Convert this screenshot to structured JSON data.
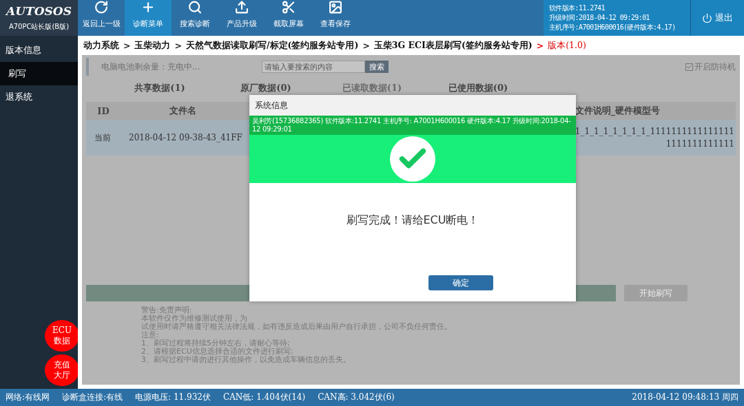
{
  "header": {
    "logo": "AUTOSOS",
    "edition": "A70PC站长版(B版)",
    "nav": [
      {
        "label": "返回上一级",
        "kind": "refresh",
        "selected": false
      },
      {
        "label": "诊断菜单",
        "kind": "medkit",
        "selected": true
      },
      {
        "label": "搜索诊断",
        "kind": "search",
        "selected": false
      },
      {
        "label": "产品升级",
        "kind": "upload",
        "selected": false
      },
      {
        "label": "截取屏幕",
        "kind": "scissors",
        "selected": false
      },
      {
        "label": "查看保存",
        "kind": "image",
        "selected": false
      }
    ],
    "info": [
      "软件版本:11.2741",
      "升级时间:2018-04-12 09:29:01",
      "主机序号:A7001H600016(硬件版本:4.17)"
    ],
    "logout": "退出"
  },
  "sidebar": {
    "items": [
      {
        "label": "版本信息",
        "selected": false
      },
      {
        "label": "刷写",
        "selected": true
      },
      {
        "label": "退系统",
        "selected": false
      }
    ],
    "badges": [
      {
        "line1": "ECU",
        "line2": "数据"
      },
      {
        "line1": "充值",
        "line2": "大厅"
      }
    ]
  },
  "breadcrumb": {
    "items": [
      "动力系统",
      "玉柴动力",
      "天然气数据读取刷写/标定(签约服务站专用)",
      "玉柴3G ECI表层刷写(签约服务站专用)"
    ],
    "current": "版本(1.0)",
    "separator": ">"
  },
  "toolbar": {
    "battery": "电脑电池剩余量：充电中...",
    "search": {
      "placeholder": "请输入要搜索的内容",
      "button": "搜索"
    },
    "standby": {
      "label": "开启防待机",
      "checked": true
    }
  },
  "tabs": [
    {
      "label": "共享数据(1)",
      "selected": false
    },
    {
      "label": "原厂数据(0)",
      "selected": false
    },
    {
      "label": "已读取数据(1)",
      "selected": true
    },
    {
      "label": "已使用数据(0)",
      "selected": false
    }
  ],
  "table": {
    "columns": [
      "ID",
      "文件名",
      "文件说明_硬件模型号"
    ],
    "rows": [
      {
        "id": "当前",
        "file": "2018-04-12 09-38-43_41FF",
        "desc": [
          "1_1_1_1_1_1_1_1_1111111111111111",
          "1111111111111"
        ],
        "selected": true
      }
    ]
  },
  "start_button": "开始刷写",
  "notice": [
    "警告:免责声明:",
    "本软件仅作为维修测试使用，为",
    "试使用时请严格遵守相关法律法规，如有违反造成后果由用户自行承担，公司不负任何责任。",
    "注意:",
    "1、刷写过程将持续5分钟左右，请耐心等待;",
    "2、请根据ECU信息选择合适的文件进行刷写;",
    "3、刷写过程中请勿进行其他操作，以免造成车辆信息的丢失。"
  ],
  "dialog": {
    "title": "系统信息",
    "info": "吴利芳(15736882365) 软件版本:11.2741 主机序号: A7001H600016 硬件版本:4.17 升级时间:2018-04-12 09:29:01",
    "message": "刷写完成！请给ECU断电！",
    "ok": "确定"
  },
  "status_bar": {
    "items": [
      "网络:有线网",
      "诊断盒连接:有线",
      "电源电压: 11.932伏",
      "CAN低: 1.404伏(14)",
      "CAN高: 3.042伏(6)"
    ],
    "datetime": "2018-04-12 09:48:13 周四"
  }
}
